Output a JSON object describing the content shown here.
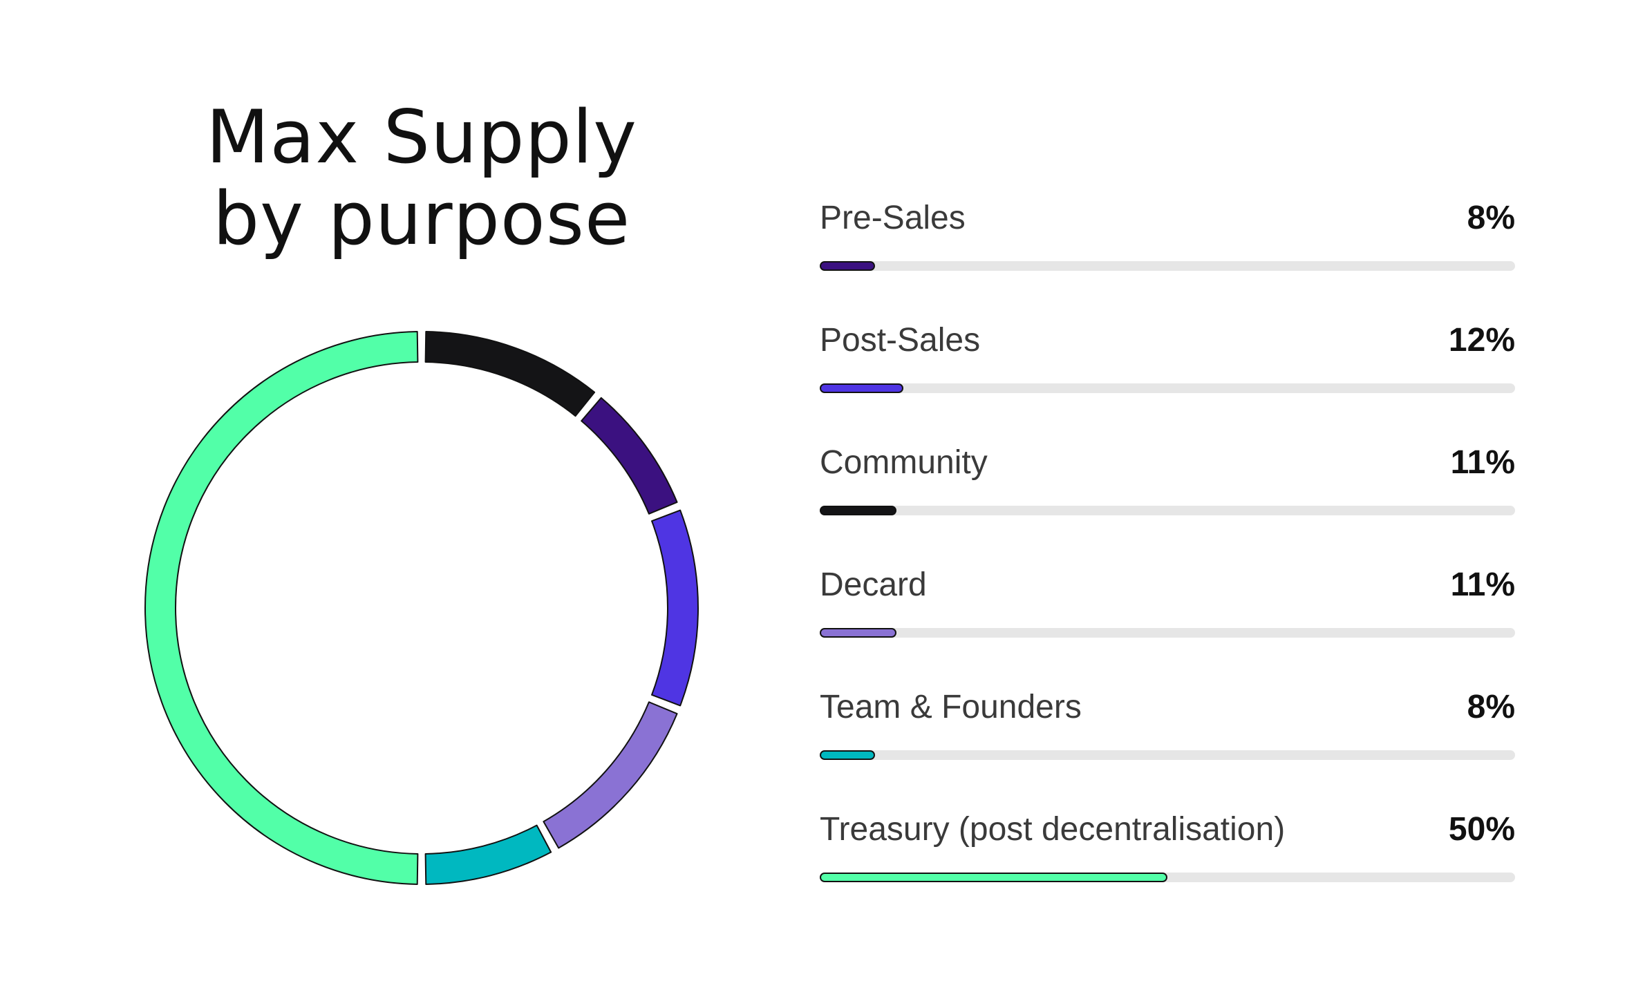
{
  "title_line1": "Max Supply",
  "title_line2": "by purpose",
  "chart_data": {
    "type": "pie",
    "title": "Max Supply by purpose",
    "categories": [
      "Pre-Sales",
      "Post-Sales",
      "Community",
      "Decard",
      "Team & Founders",
      "Treasury (post decentralisation)"
    ],
    "values": [
      8,
      12,
      11,
      11,
      8,
      50
    ],
    "value_labels": [
      "8%",
      "12%",
      "11%",
      "11%",
      "8%",
      "50%"
    ],
    "colors": [
      "#3b1180",
      "#4f35e3",
      "#141416",
      "#8a72d4",
      "#00b8c0",
      "#52ffa8"
    ],
    "donut_order": [
      "Community",
      "Pre-Sales",
      "Post-Sales",
      "Decard",
      "Team & Founders",
      "Treasury (post decentralisation)"
    ],
    "legend_placement": "right"
  }
}
